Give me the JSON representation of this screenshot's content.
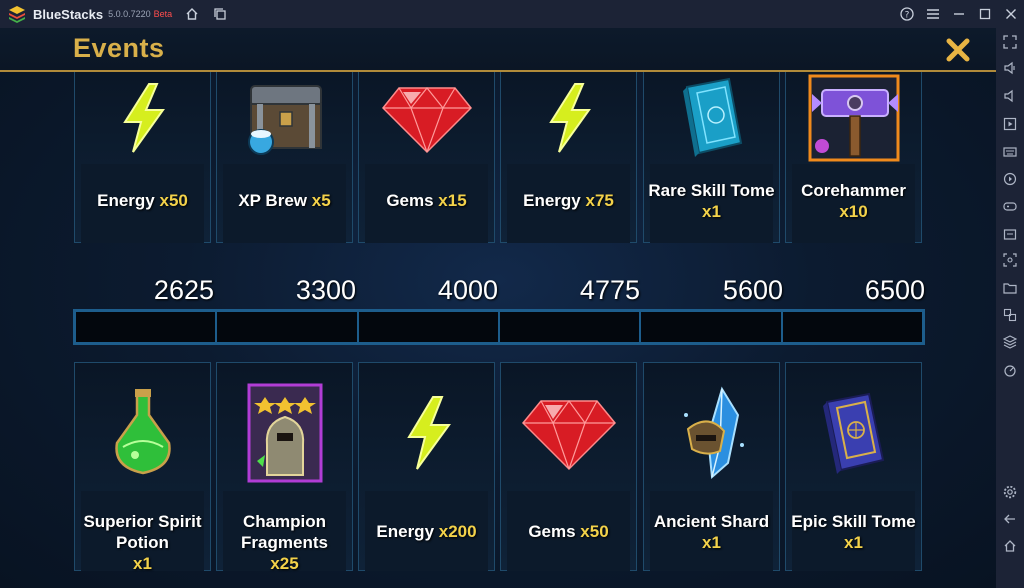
{
  "window": {
    "app_name": "BlueStacks",
    "version": "5.0.0.7220",
    "channel": "Beta"
  },
  "header": {
    "title": "Events"
  },
  "top_rewards": [
    {
      "icon": "energy-bolt-icon",
      "name": "Energy",
      "qty": "x50"
    },
    {
      "icon": "xp-brew-chest-icon",
      "name": "XP Brew",
      "qty": "x5"
    },
    {
      "icon": "red-gem-icon",
      "name": "Gems",
      "qty": "x15"
    },
    {
      "icon": "energy-bolt-icon",
      "name": "Energy",
      "qty": "x75"
    },
    {
      "icon": "rare-skill-tome-icon",
      "name": "Rare Skill Tome",
      "qty": "x1"
    },
    {
      "icon": "corehammer-icon",
      "name": "Corehammer",
      "qty": "x10"
    }
  ],
  "milestones": [
    "2625",
    "3300",
    "4000",
    "4775",
    "5600",
    "6500"
  ],
  "progress_fraction": 0,
  "bottom_rewards": [
    {
      "icon": "spirit-potion-icon",
      "name": "Superior Spirit Potion",
      "qty": "x1"
    },
    {
      "icon": "champion-card-icon",
      "name": "Champion Fragments",
      "qty": "x25"
    },
    {
      "icon": "energy-bolt-icon",
      "name": "Energy",
      "qty": "x200"
    },
    {
      "icon": "red-gem-icon",
      "name": "Gems",
      "qty": "x50"
    },
    {
      "icon": "ancient-shard-icon",
      "name": "Ancient Shard",
      "qty": "x1"
    },
    {
      "icon": "epic-skill-tome-icon",
      "name": "Epic Skill Tome",
      "qty": "x1"
    }
  ],
  "colors": {
    "title_gold": "#d9b04a",
    "quantity_yellow": "#f3d24a",
    "card_border": "#1f4a6a",
    "progress_border": "#1d5d8c"
  }
}
